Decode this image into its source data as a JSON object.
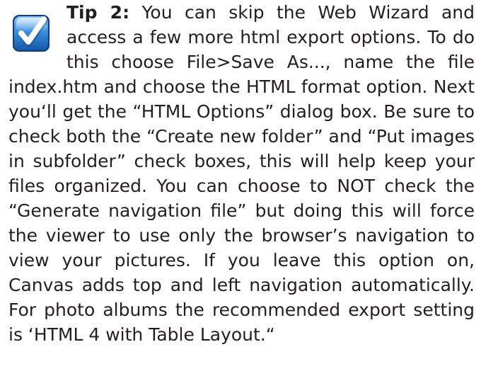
{
  "tip": {
    "label": "Tip 2:",
    "icon": "checkmark-icon",
    "body": " You can skip the Web Wizard and access a few more html export options. To do this choose File>Save As..., name the file index.htm and choose the HTML format option. Next you‘ll get the “HTML Options” dialog box. Be sure to check both the “Create new fold­er” and “Put images in subfolder” check boxes, this will help keep your files organized. You can choose to NOT check the “Generate navigation file” but doing this will force the viewer to use only the browser’s navigation to view your pic­tures. If you leave this option on, Canvas adds top and left navigation automatically. For photo albums the recommended export setting is ‘HTML 4 with Table Layout.“"
  },
  "colors": {
    "text": "#231f20",
    "icon_blue": "#1f6fc9",
    "icon_blue_light": "#6fb3f0",
    "icon_check": "#ffffff"
  }
}
